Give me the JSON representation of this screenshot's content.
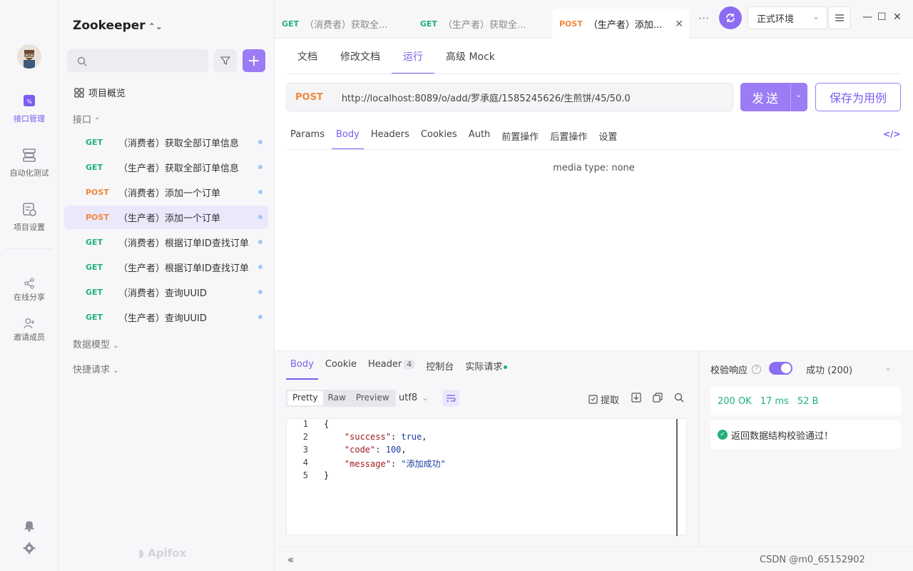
{
  "rail": {
    "items": [
      {
        "label": "接口管理",
        "icon": "api-icon",
        "active": true
      },
      {
        "label": "自动化测试",
        "icon": "automation-icon"
      },
      {
        "label": "项目设置",
        "icon": "settings-doc-icon"
      },
      {
        "label": "在线分享",
        "icon": "share-icon"
      },
      {
        "label": "邀请成员",
        "icon": "user-add-icon"
      }
    ]
  },
  "sidebar": {
    "project": "Zookeeper",
    "overview": "项目概览",
    "sections": {
      "api": "接口",
      "models": "数据模型",
      "quick": "快捷请求"
    },
    "apis": [
      {
        "method": "GET",
        "name": "（消费者）获取全部订单信息"
      },
      {
        "method": "GET",
        "name": "（生产者）获取全部订单信息"
      },
      {
        "method": "POST",
        "name": "（消费者）添加一个订单"
      },
      {
        "method": "POST",
        "name": "（生产者）添加一个订单"
      },
      {
        "method": "GET",
        "name": "（消费者）根据订单ID查找订单"
      },
      {
        "method": "GET",
        "name": "（生产者）根据订单ID查找订单"
      },
      {
        "method": "GET",
        "name": "（消费者）查询UUID"
      },
      {
        "method": "GET",
        "name": "（生产者）查询UUID"
      }
    ],
    "brand": "Apifox"
  },
  "tabs": [
    {
      "method": "GET",
      "title": "（消费者）获取全..."
    },
    {
      "method": "GET",
      "title": "（生产者）获取全..."
    },
    {
      "method": "POST",
      "title": "（生产者）添加..."
    }
  ],
  "env": "正式环境",
  "subtabs": [
    "文档",
    "修改文档",
    "运行",
    "高级 Mock"
  ],
  "request": {
    "method": "POST",
    "url": "http://localhost:8089/o/add/罗承庭/1585245626/生煎饼/45/50.0",
    "send": "发送",
    "save": "保存为用例"
  },
  "ptabs": [
    "Params",
    "Body",
    "Headers",
    "Cookies",
    "Auth",
    "前置操作",
    "后置操作",
    "设置"
  ],
  "media_type": "media type: none",
  "response": {
    "tabs": [
      "Body",
      "Cookie",
      "Header",
      "控制台",
      "实际请求"
    ],
    "header_count": "4",
    "formats": [
      "Pretty",
      "Raw",
      "Preview"
    ],
    "encoding": "utf8",
    "extract": "提取",
    "lines": [
      {
        "n": "1",
        "text": "{"
      },
      {
        "n": "2",
        "key": "\"success\"",
        "sep": ": ",
        "val": "true",
        "end": ","
      },
      {
        "n": "3",
        "key": "\"code\"",
        "sep": ": ",
        "val": "100",
        "end": ","
      },
      {
        "n": "4",
        "key": "\"message\"",
        "sep": ": ",
        "val": "\"添加成功\"",
        "end": ""
      },
      {
        "n": "5",
        "text": "}"
      }
    ]
  },
  "verify": {
    "label": "校验响应",
    "status": "成功 (200)",
    "code": "200 OK",
    "time": "17 ms",
    "size": "52 B",
    "message": "返回数据结构校验通过！"
  },
  "footer": {
    "text": "CSDN @m0_65152902"
  },
  "colors": {
    "accent": "#8b6cf2",
    "get": "#20b07a",
    "post": "#f0883a"
  }
}
